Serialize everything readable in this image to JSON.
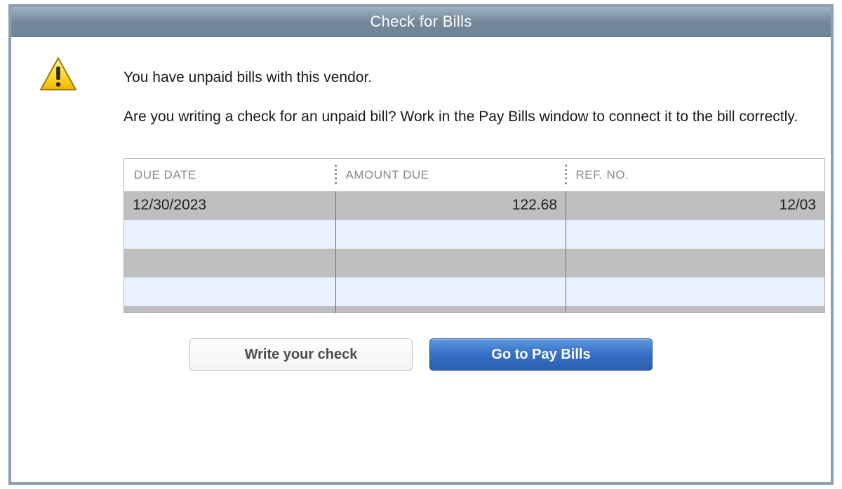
{
  "dialog": {
    "title": "Check for Bills",
    "message1": "You have unpaid bills with this vendor.",
    "message2": "Are you writing a check for an unpaid bill? Work in the Pay Bills window to connect it to the bill correctly."
  },
  "table": {
    "headers": {
      "due_date": "DUE DATE",
      "amount_due": "AMOUNT DUE",
      "ref_no": "REF. NO."
    },
    "rows": [
      {
        "due_date": "12/30/2023",
        "amount_due": "122.68",
        "ref_no": "12/03"
      },
      {
        "due_date": "",
        "amount_due": "",
        "ref_no": ""
      },
      {
        "due_date": "",
        "amount_due": "",
        "ref_no": ""
      },
      {
        "due_date": "",
        "amount_due": "",
        "ref_no": ""
      },
      {
        "due_date": "",
        "amount_due": "",
        "ref_no": ""
      }
    ]
  },
  "buttons": {
    "write_check": "Write your check",
    "go_to_pay_bills": "Go to Pay Bills"
  }
}
